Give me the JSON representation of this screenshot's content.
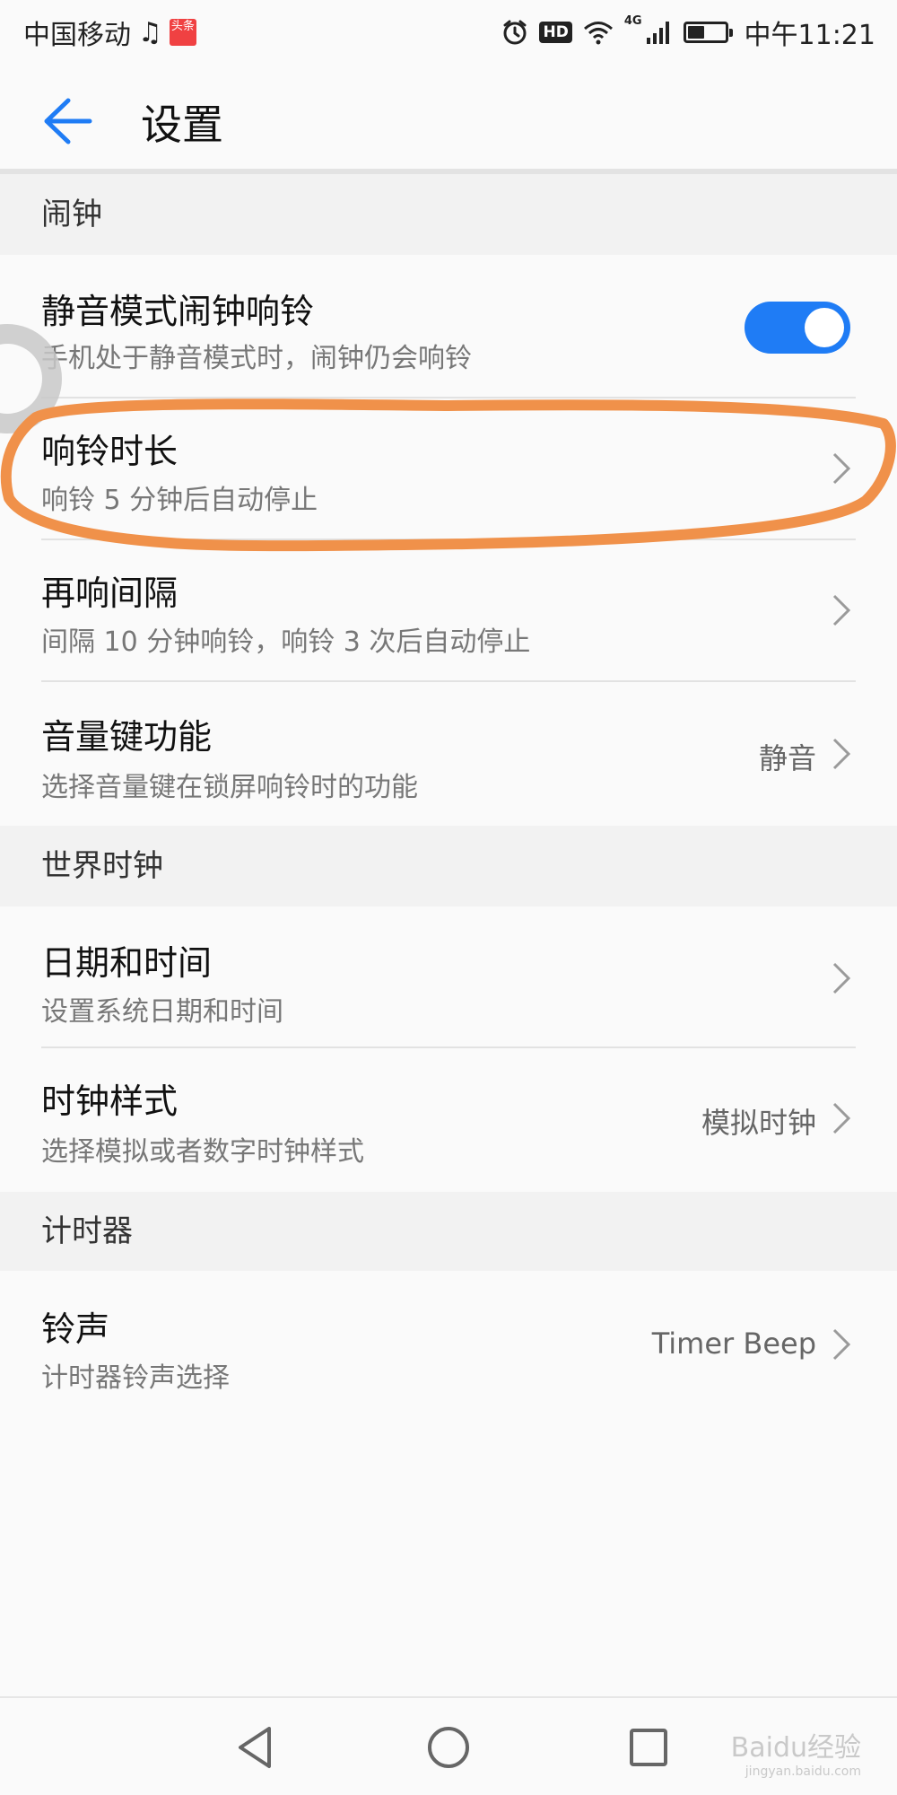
{
  "status_bar": {
    "carrier": "中国移动",
    "app_badge": "头条",
    "hd": "HD",
    "network": "4G",
    "time": "中午11:21",
    "battery_level": 0.45
  },
  "header": {
    "title": "设置"
  },
  "sections": [
    {
      "title": "闹钟",
      "items": [
        {
          "title": "静音模式闹钟响铃",
          "subtitle": "手机处于静音模式时，闹钟仍会响铃",
          "toggle_on": true
        },
        {
          "title": "响铃时长",
          "subtitle": "响铃 5 分钟后自动停止"
        },
        {
          "title": "再响间隔",
          "subtitle": "间隔 10 分钟响铃，响铃 3 次后自动停止"
        },
        {
          "title": "音量键功能",
          "subtitle": "选择音量键在锁屏响铃时的功能",
          "value": "静音"
        }
      ]
    },
    {
      "title": "世界时钟",
      "items": [
        {
          "title": "日期和时间",
          "subtitle": "设置系统日期和时间"
        },
        {
          "title": "时钟样式",
          "subtitle": "选择模拟或者数字时钟样式",
          "value": "模拟时钟"
        }
      ]
    },
    {
      "title": "计时器",
      "items": [
        {
          "title": "铃声",
          "subtitle": "计时器铃声选择",
          "value": "Timer Beep"
        }
      ]
    }
  ],
  "watermark": {
    "brand": "Baidu经验",
    "url": "jingyan.baidu.com"
  },
  "colors": {
    "accent": "#1f7cf5",
    "annotation": "#f0914a"
  }
}
